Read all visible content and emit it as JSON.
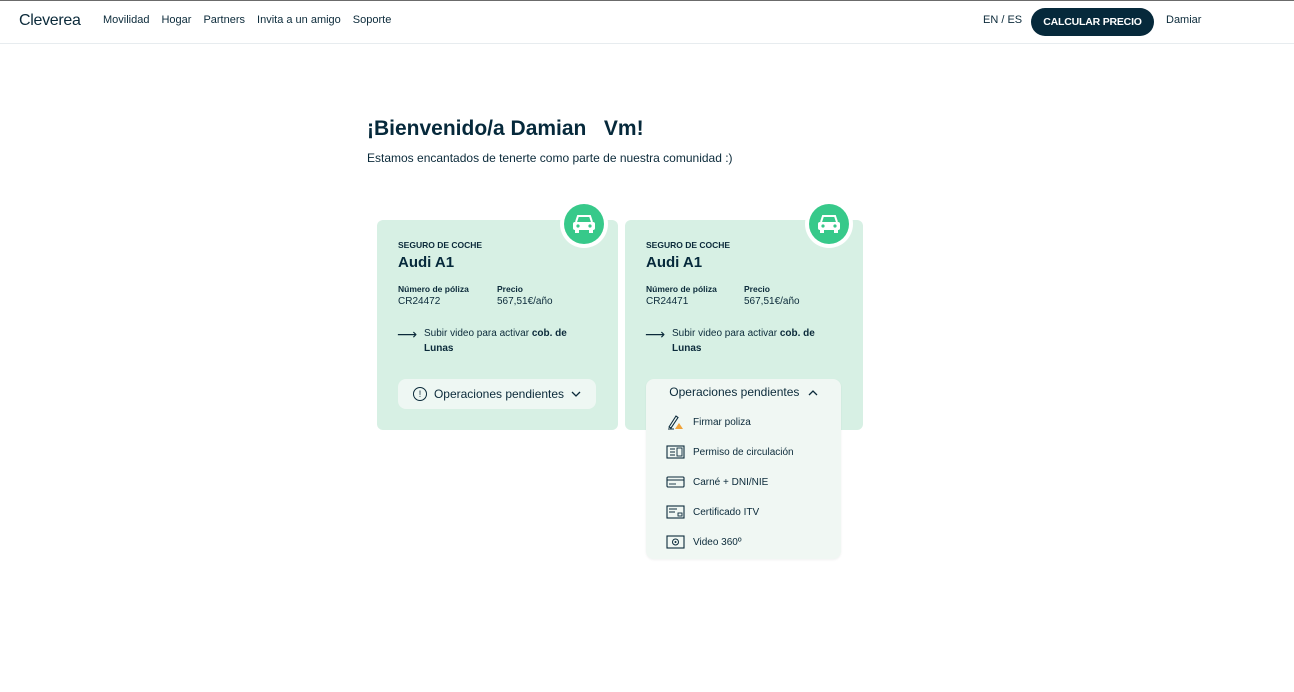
{
  "header": {
    "logo": "Cleverea",
    "nav": [
      "Movilidad",
      "Hogar",
      "Partners",
      "Invita a un amigo",
      "Soporte"
    ],
    "lang": "EN / ES",
    "cta_label": "CALCULAR PRECIO",
    "user_name": "Damiar"
  },
  "welcome": {
    "title": "¡Bienvenido/a Damian   Vm!",
    "subtitle": "Estamos encantados de tenerte como parte de nuestra comunidad :)"
  },
  "cards": [
    {
      "type": "SEGURO DE COCHE",
      "model": "Audi A1",
      "policy_label": "Número de póliza",
      "policy_value": "CR24472",
      "price_label": "Precio",
      "price_value": "567,51€/año",
      "task_prefix": "Subir video para activar ",
      "task_bold": "cob. de Lunas",
      "ops_label": "Operaciones pendientes",
      "icon": "car-icon"
    },
    {
      "type": "SEGURO DE COCHE",
      "model": "Audi A1",
      "policy_label": "Número de póliza",
      "policy_value": "CR24471",
      "price_label": "Precio",
      "price_value": "567,51€/año",
      "task_prefix": "Subir video para activar ",
      "task_bold": "cob. de Lunas",
      "ops_label": "Operaciones pendientes",
      "icon": "car-icon"
    }
  ],
  "pending_ops": {
    "items": [
      {
        "label": "Firmar poliza",
        "icon": "sign-warning-icon"
      },
      {
        "label": "Permiso de circulación",
        "icon": "document-icon"
      },
      {
        "label": "Carné + DNI/NIE",
        "icon": "id-card-icon"
      },
      {
        "label": "Certificado ITV",
        "icon": "certificate-icon"
      },
      {
        "label": "Video 360º",
        "icon": "camera-icon"
      }
    ]
  },
  "colors": {
    "primary": "#06293b",
    "card_bg": "#d7f0e4",
    "accent_green": "#37c98a",
    "warning": "#f0a33a"
  }
}
